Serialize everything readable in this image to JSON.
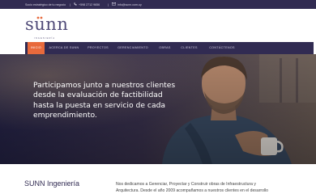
{
  "topbar": {
    "tagline": "Socio estratégico de tu negocio",
    "separator": "|",
    "phone": "+598 2712 9656",
    "email": "info@sunn.com.uy"
  },
  "logo": {
    "word": "sunn",
    "subtitle": "INGENIERÍA"
  },
  "nav": {
    "items": [
      {
        "label": "INICIO",
        "active": true
      },
      {
        "label": "ACERCA DE SUNN"
      },
      {
        "label": "PROYECTOS"
      },
      {
        "label": "GERENCIAMIENTO"
      },
      {
        "label": "OBRAS"
      },
      {
        "label": "CLIENTES"
      },
      {
        "label": "CONTÁCTENOS"
      }
    ]
  },
  "hero": {
    "text": "Participamos junto a nuestros clientes\ndesde la evaluación de factibilidad\nhasta la puesta en servicio de cada\nemprendimiento."
  },
  "intro": {
    "title": "SUNN Ingeniería",
    "text": "Nos dedicamos a Gerenciar, Proyectar y Construir obras de Infraestructura y\nArquitectura. Desde el año 2009 acompañamos a nuestros clientes en el desarrollo"
  },
  "colors": {
    "brand_dark": "#312b52",
    "accent": "#e86a3c"
  },
  "icons": [
    "phone-icon",
    "mail-icon"
  ]
}
